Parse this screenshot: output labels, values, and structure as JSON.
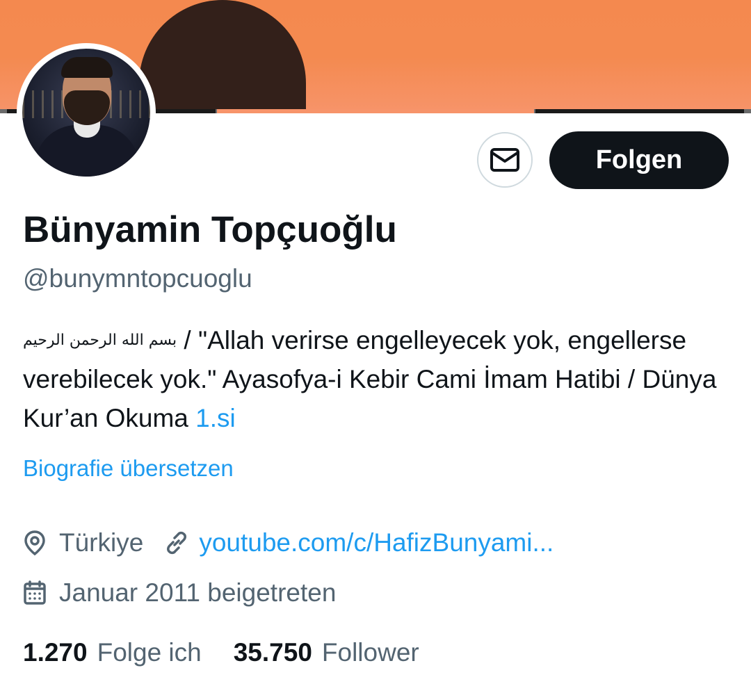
{
  "profile": {
    "name": "Bünyamin Topçuoğlu",
    "handle": "@bunymntopcuoglu",
    "bio_basmala": "بسم الله الرحمن الرحيم",
    "bio_text": " / \"Allah verirse engelleyecek yok, engellerse verebilecek yok.\" Ayasofya-i Kebir Cami İmam Hatibi / Dünya Kur’an Okuma ",
    "bio_link": "1.si",
    "translate_label": "Biografie übersetzen",
    "location": "Türkiye",
    "website": "youtube.com/c/HafizBunyami...",
    "joined": "Januar 2011 beigetreten"
  },
  "actions": {
    "message_icon": "mail-icon",
    "follow_label": "Folgen"
  },
  "stats": {
    "following_count": "1.270",
    "following_label": "Folge ich",
    "followers_count": "35.750",
    "followers_label": "Follower"
  },
  "icons": {
    "location": "location-pin-icon",
    "website": "link-icon",
    "joined": "calendar-icon"
  },
  "colors": {
    "accent_link": "#1d9bf0",
    "secondary_text": "#536471",
    "primary_text": "#0f1419",
    "banner": "#f48a50"
  }
}
